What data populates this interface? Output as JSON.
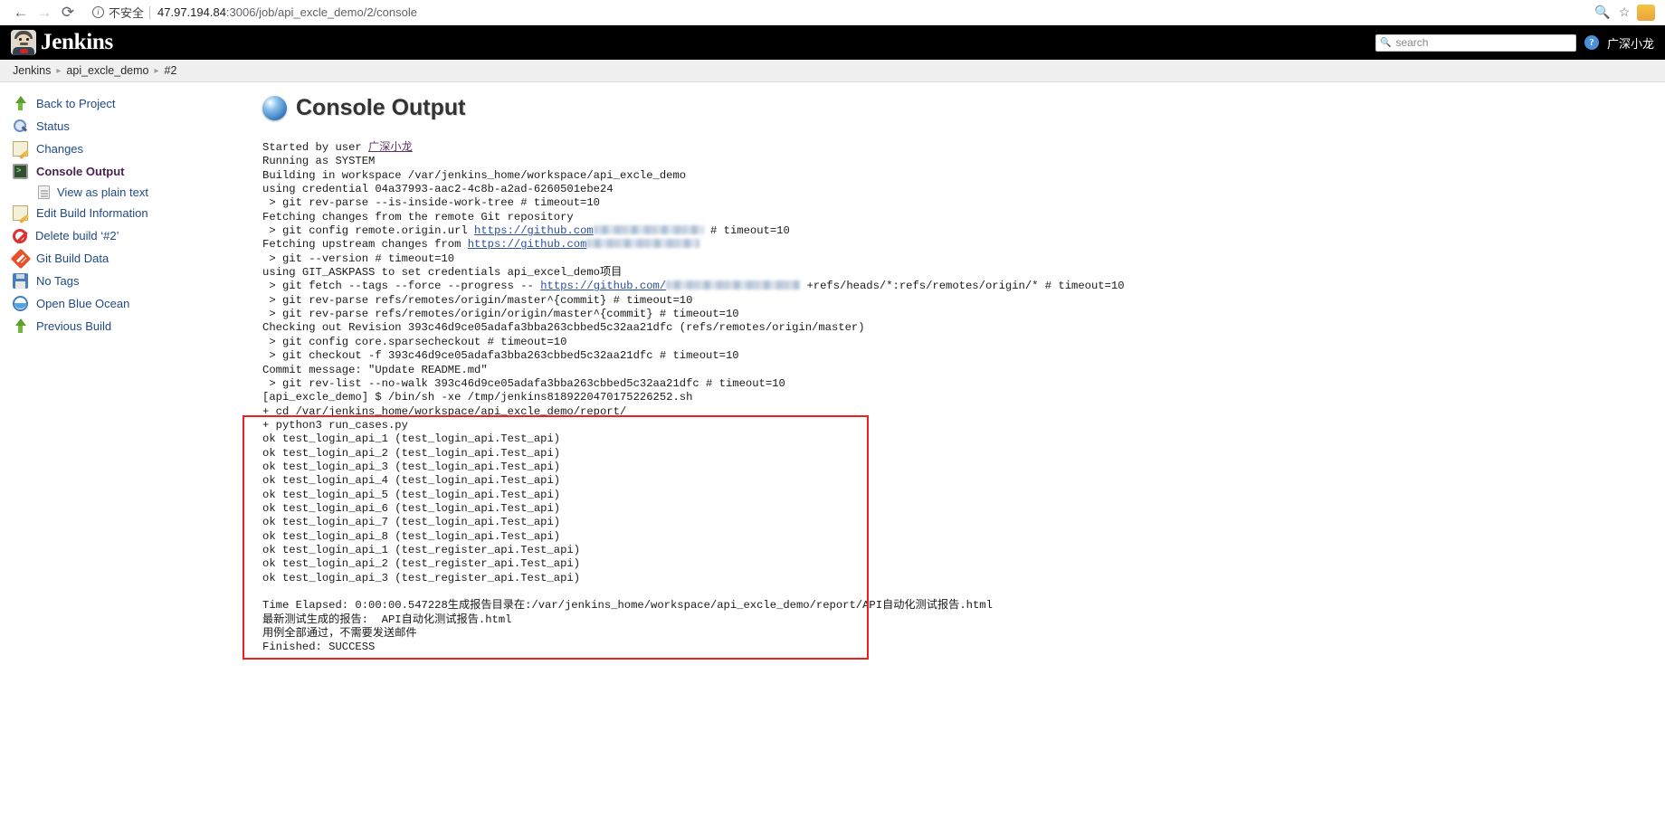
{
  "browser": {
    "back_icon": "back-arrow-icon",
    "forward_icon": "forward-arrow-icon",
    "reload_icon": "reload-icon",
    "security_label": "不安全",
    "url_host": "47.97.194.84",
    "url_path": ":3006/job/api_excle_demo/2/console",
    "zoom_icon": "zoom-search-icon",
    "bookmark_icon": "star-icon",
    "extension_icon": "puzzle-extension-icon"
  },
  "header": {
    "brand": "Jenkins",
    "search_placeholder": "search",
    "search_value": "",
    "help_label": "?",
    "user_name": "广深小龙"
  },
  "breadcrumb": {
    "items": [
      "Jenkins",
      "api_excle_demo",
      "#2"
    ],
    "separator": "▸"
  },
  "sidebar": {
    "items": [
      {
        "label": "Back to Project",
        "icon": "up-arrow-icon",
        "active": false
      },
      {
        "label": "Status",
        "icon": "magnifier-icon",
        "active": false
      },
      {
        "label": "Changes",
        "icon": "pencil-note-icon",
        "active": false
      },
      {
        "label": "Console Output",
        "icon": "terminal-icon",
        "active": true
      },
      {
        "label": "Edit Build Information",
        "icon": "pencil-note-icon",
        "active": false
      },
      {
        "label": "Delete build ‘#2’",
        "icon": "deny-icon",
        "active": false
      },
      {
        "label": "Git Build Data",
        "icon": "git-icon",
        "active": false
      },
      {
        "label": "No Tags",
        "icon": "floppy-icon",
        "active": false
      },
      {
        "label": "Open Blue Ocean",
        "icon": "blue-ocean-icon",
        "active": false
      },
      {
        "label": "Previous Build",
        "icon": "up-arrow-icon",
        "active": false
      }
    ],
    "sub_item": {
      "label": "View as plain text",
      "icon": "document-icon"
    }
  },
  "main": {
    "title": "Console Output",
    "orb_icon": "blue-orb-icon",
    "log": {
      "started_by_prefix": "Started by user ",
      "started_by_user": "广深小龙",
      "line_running_as": "Running as SYSTEM",
      "line_building": "Building in workspace /var/jenkins_home/workspace/api_excle_demo",
      "line_credential": "using credential 04a37993-aac2-4c8b-a2ad-6260501ebe24",
      "line_rev_parse_inside": " > git rev-parse --is-inside-work-tree # timeout=10",
      "line_fetching_changes": "Fetching changes from the remote Git repository",
      "line_config_origin_pre": " > git config remote.origin.url ",
      "line_config_origin_url": "https://github.com",
      "line_config_origin_post": " # timeout=10",
      "line_fetch_upstream_pre": "Fetching upstream changes from ",
      "line_fetch_upstream_url": "https://github.com",
      "line_git_version": " > git --version # timeout=10",
      "line_askpass": "using GIT_ASKPASS to set credentials api_excel_demo项目",
      "line_fetch_pre": " > git fetch --tags --force --progress -- ",
      "line_fetch_url": "https://github.com/",
      "line_fetch_post": " +refs/heads/*:refs/remotes/origin/* # timeout=10",
      "line_revparse_master": " > git rev-parse refs/remotes/origin/master^{commit} # timeout=10",
      "line_revparse_origin_master": " > git rev-parse refs/remotes/origin/origin/master^{commit} # timeout=10",
      "line_checkout_revision": "Checking out Revision 393c46d9ce05adafa3bba263cbbed5c32aa21dfc (refs/remotes/origin/master)",
      "line_sparsecheckout": " > git config core.sparsecheckout # timeout=10",
      "line_checkout_f": " > git checkout -f 393c46d9ce05adafa3bba263cbbed5c32aa21dfc # timeout=10",
      "line_commit_message": "Commit message: \"Update README.md\"",
      "line_revlist": " > git rev-list --no-walk 393c46d9ce05adafa3bba263cbbed5c32aa21dfc # timeout=10",
      "line_shell": "[api_excle_demo] $ /bin/sh -xe /tmp/jenkins8189220470175226252.sh",
      "line_cd": "+ cd /var/jenkins_home/workspace/api_excle_demo/report/",
      "line_python": "+ python3 run_cases.py",
      "test_results": [
        "ok test_login_api_1 (test_login_api.Test_api)",
        "ok test_login_api_2 (test_login_api.Test_api)",
        "ok test_login_api_3 (test_login_api.Test_api)",
        "ok test_login_api_4 (test_login_api.Test_api)",
        "ok test_login_api_5 (test_login_api.Test_api)",
        "ok test_login_api_6 (test_login_api.Test_api)",
        "ok test_login_api_7 (test_login_api.Test_api)",
        "ok test_login_api_8 (test_login_api.Test_api)",
        "ok test_login_api_1 (test_register_api.Test_api)",
        "ok test_login_api_2 (test_register_api.Test_api)",
        "ok test_login_api_3 (test_register_api.Test_api)"
      ],
      "line_time_elapsed": "Time Elapsed: 0:00:00.547228生成报告目录在:/var/jenkins_home/workspace/api_excle_demo/report/API自动化测试报告.html",
      "line_latest_report": "最新测试生成的报告:  API自动化测试报告.html",
      "line_all_pass": "用例全部通过，不需要发送邮件",
      "line_finished": "Finished: SUCCESS"
    }
  },
  "colors": {
    "header_bg": "#000000",
    "link": "#204a87",
    "active_item": "#4b1f52",
    "highlight_box": "#f01f1f",
    "breadcrumb_bg": "#f0f0f0"
  }
}
